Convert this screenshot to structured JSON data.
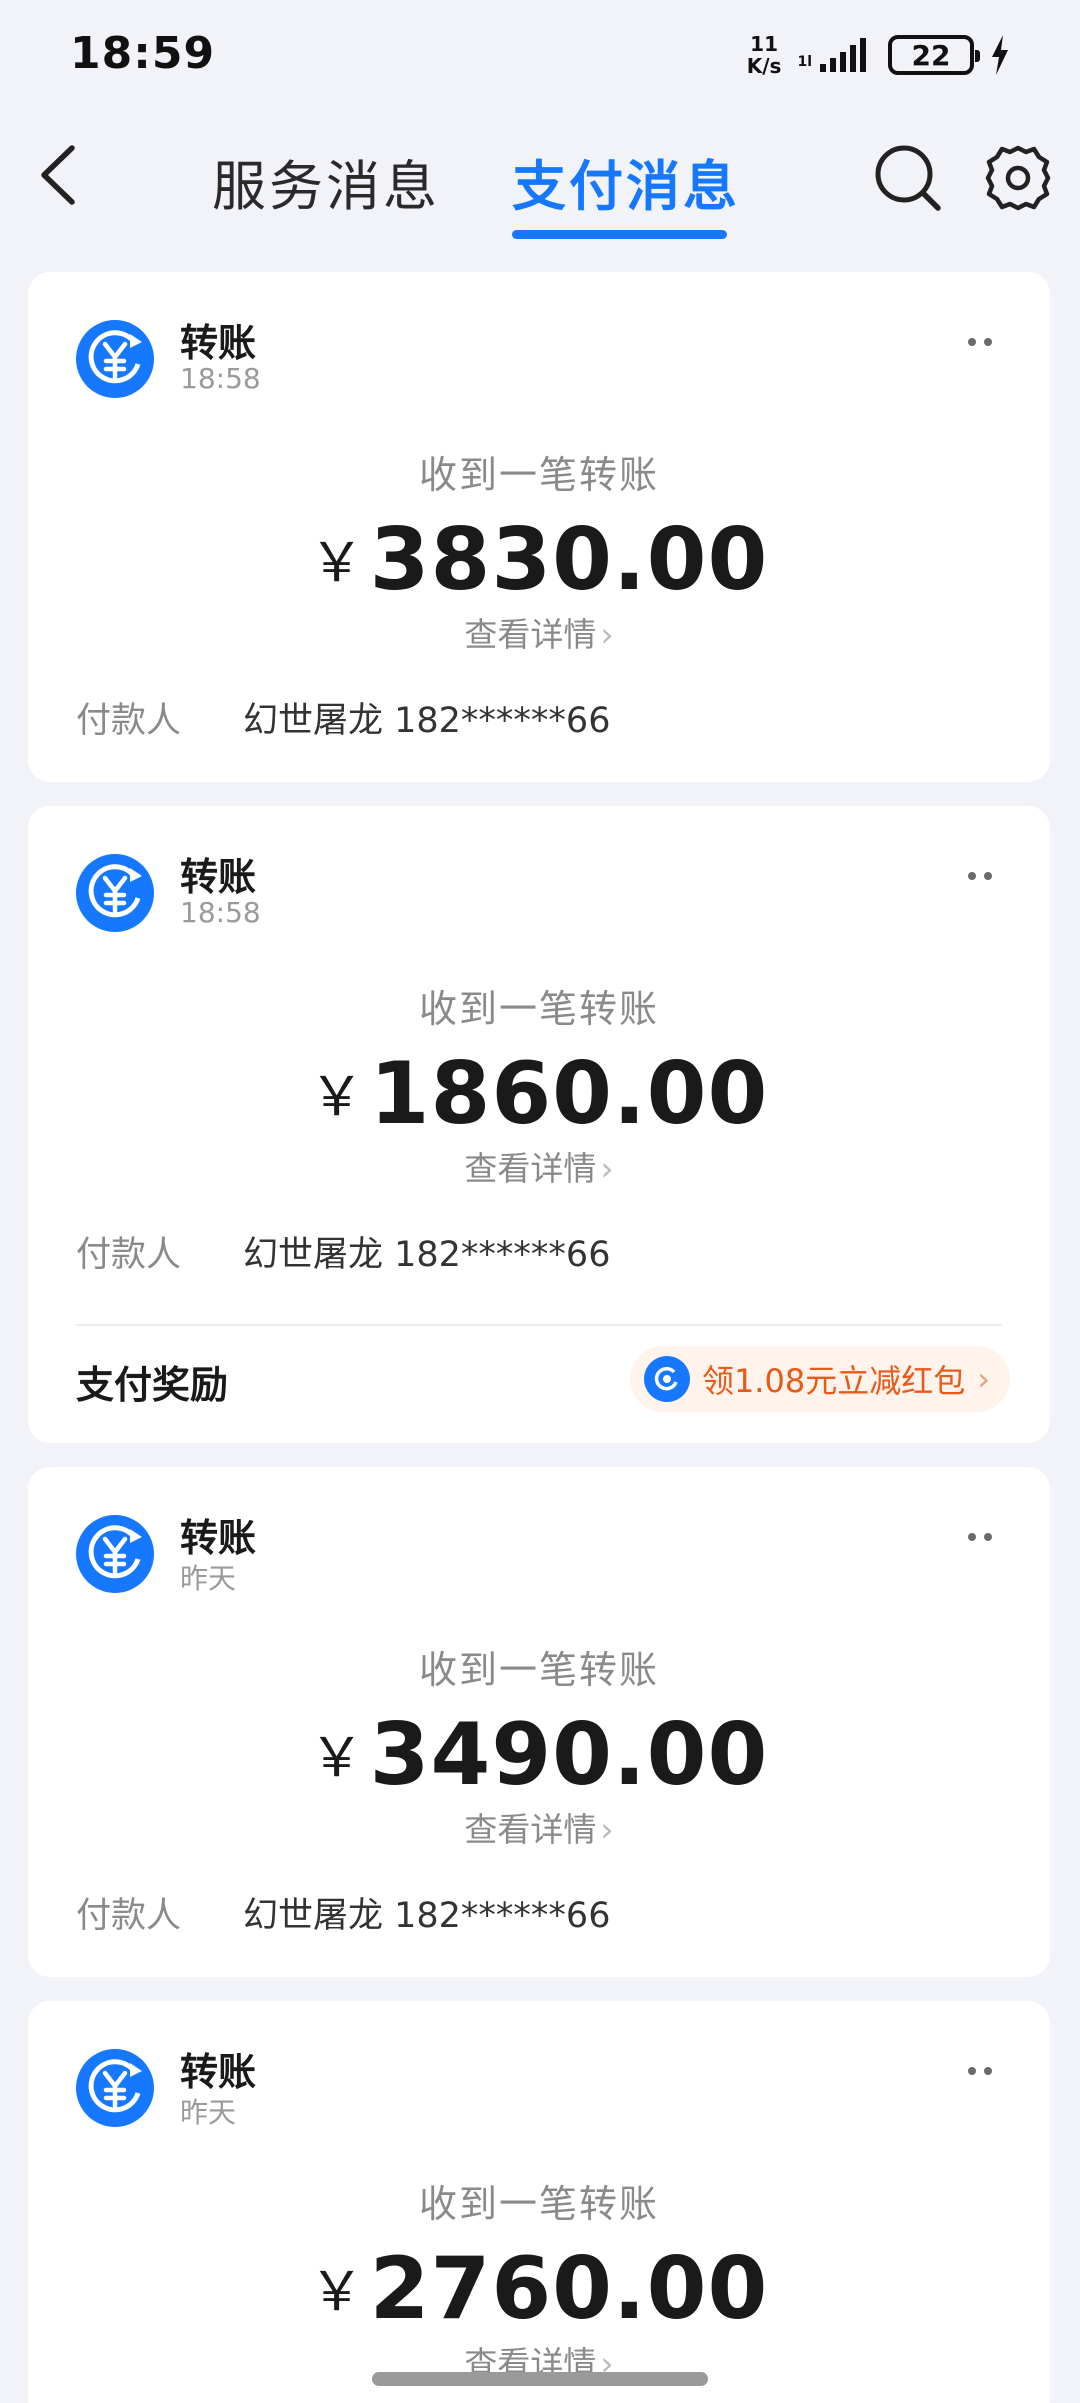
{
  "status_bar": {
    "time": "18:59",
    "net_speed_value": "11",
    "net_speed_unit": "K/s",
    "signal_small": "1l",
    "battery": "22"
  },
  "header": {
    "tabs": [
      {
        "label": "服务消息",
        "active": false
      },
      {
        "label": "支付消息",
        "active": true
      }
    ],
    "accent_color": "#1677ff"
  },
  "icons": {
    "back": "back-arrow-icon",
    "search": "search-icon",
    "settings": "gear-icon",
    "transfer": "yuan-transfer-icon",
    "more": "more-dots-icon"
  },
  "cards": [
    {
      "title": "转账",
      "time": "18:58",
      "subtitle": "收到一笔转账",
      "currency": "￥",
      "amount": "3830.00",
      "detail_link": "查看详情",
      "payer_label": "付款人",
      "payer_value": "幻世屠龙 182******66"
    },
    {
      "title": "转账",
      "time": "18:58",
      "subtitle": "收到一笔转账",
      "currency": "￥",
      "amount": "1860.00",
      "detail_link": "查看详情",
      "payer_label": "付款人",
      "payer_value": "幻世屠龙 182******66",
      "reward_label": "支付奖励",
      "reward_button": "领1.08元立减红包"
    },
    {
      "title": "转账",
      "time": "昨天",
      "subtitle": "收到一笔转账",
      "currency": "￥",
      "amount": "3490.00",
      "detail_link": "查看详情",
      "payer_label": "付款人",
      "payer_value": "幻世屠龙 182******66"
    },
    {
      "title": "转账",
      "time": "昨天",
      "subtitle": "收到一笔转账",
      "currency": "￥",
      "amount": "2760.00",
      "detail_link": "查看详情"
    }
  ]
}
